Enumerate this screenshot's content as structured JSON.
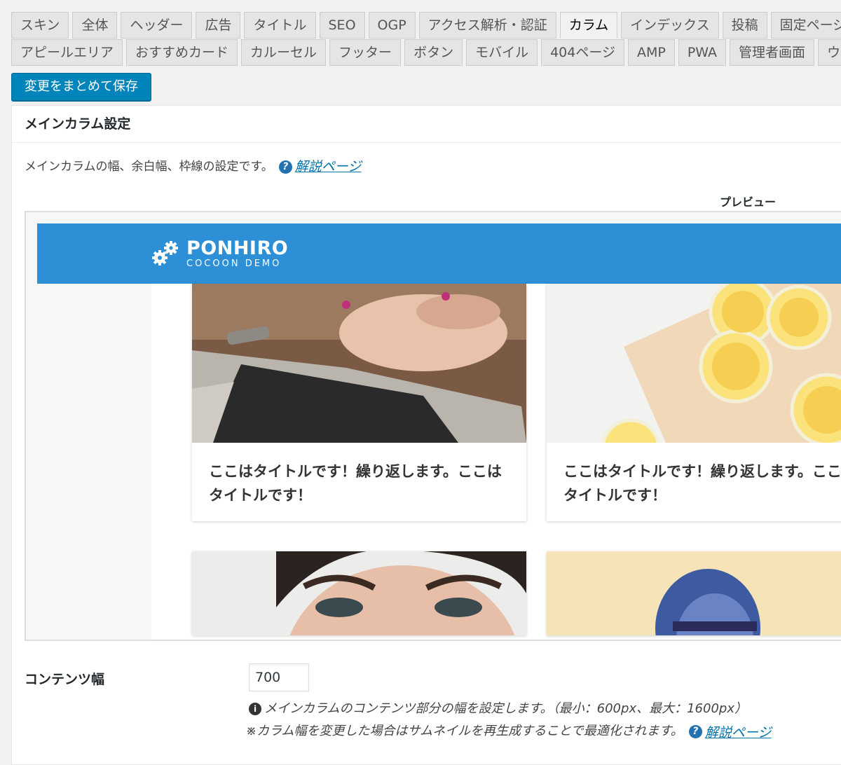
{
  "tabs": {
    "row1": [
      "スキン",
      "全体",
      "ヘッダー",
      "広告",
      "タイトル",
      "SEO",
      "OGP",
      "アクセス解析・認証",
      "カラム",
      "インデックス",
      "投稿",
      "固定ページ"
    ],
    "row2": [
      "アピールエリア",
      "おすすめカード",
      "カルーセル",
      "フッター",
      "ボタン",
      "モバイル",
      "404ページ",
      "AMP",
      "PWA",
      "管理者画面",
      "ウィ"
    ],
    "active": "カラム"
  },
  "save_button": "変更をまとめて保存",
  "panel": {
    "title": "メインカラム設定",
    "description": "メインカラムの幅、余白幅、枠線の設定です。",
    "help_icon": "question-circle-icon",
    "help_link": "解説ページ"
  },
  "preview": {
    "label": "プレビュー",
    "site_title": "PONHIRO",
    "site_desc": "COCOON DEMO",
    "header_color": "#2d8fd5",
    "cards": [
      {
        "title": "ここはタイトルです！繰り返します。ここはタイトルです！"
      },
      {
        "title": "ここはタイトルです！繰り返します。ここはタイトルです！"
      },
      {
        "title": ""
      },
      {
        "title": ""
      }
    ]
  },
  "content_width": {
    "label": "コンテンツ幅",
    "value": "700",
    "info": "メインカラムのコンテンツ部分の幅を設定します。（最小：600px、最大：1600px）",
    "note": "※カラム幅を変更した場合はサムネイルを再生成することで最適化されます。",
    "help_link": "解説ページ"
  }
}
